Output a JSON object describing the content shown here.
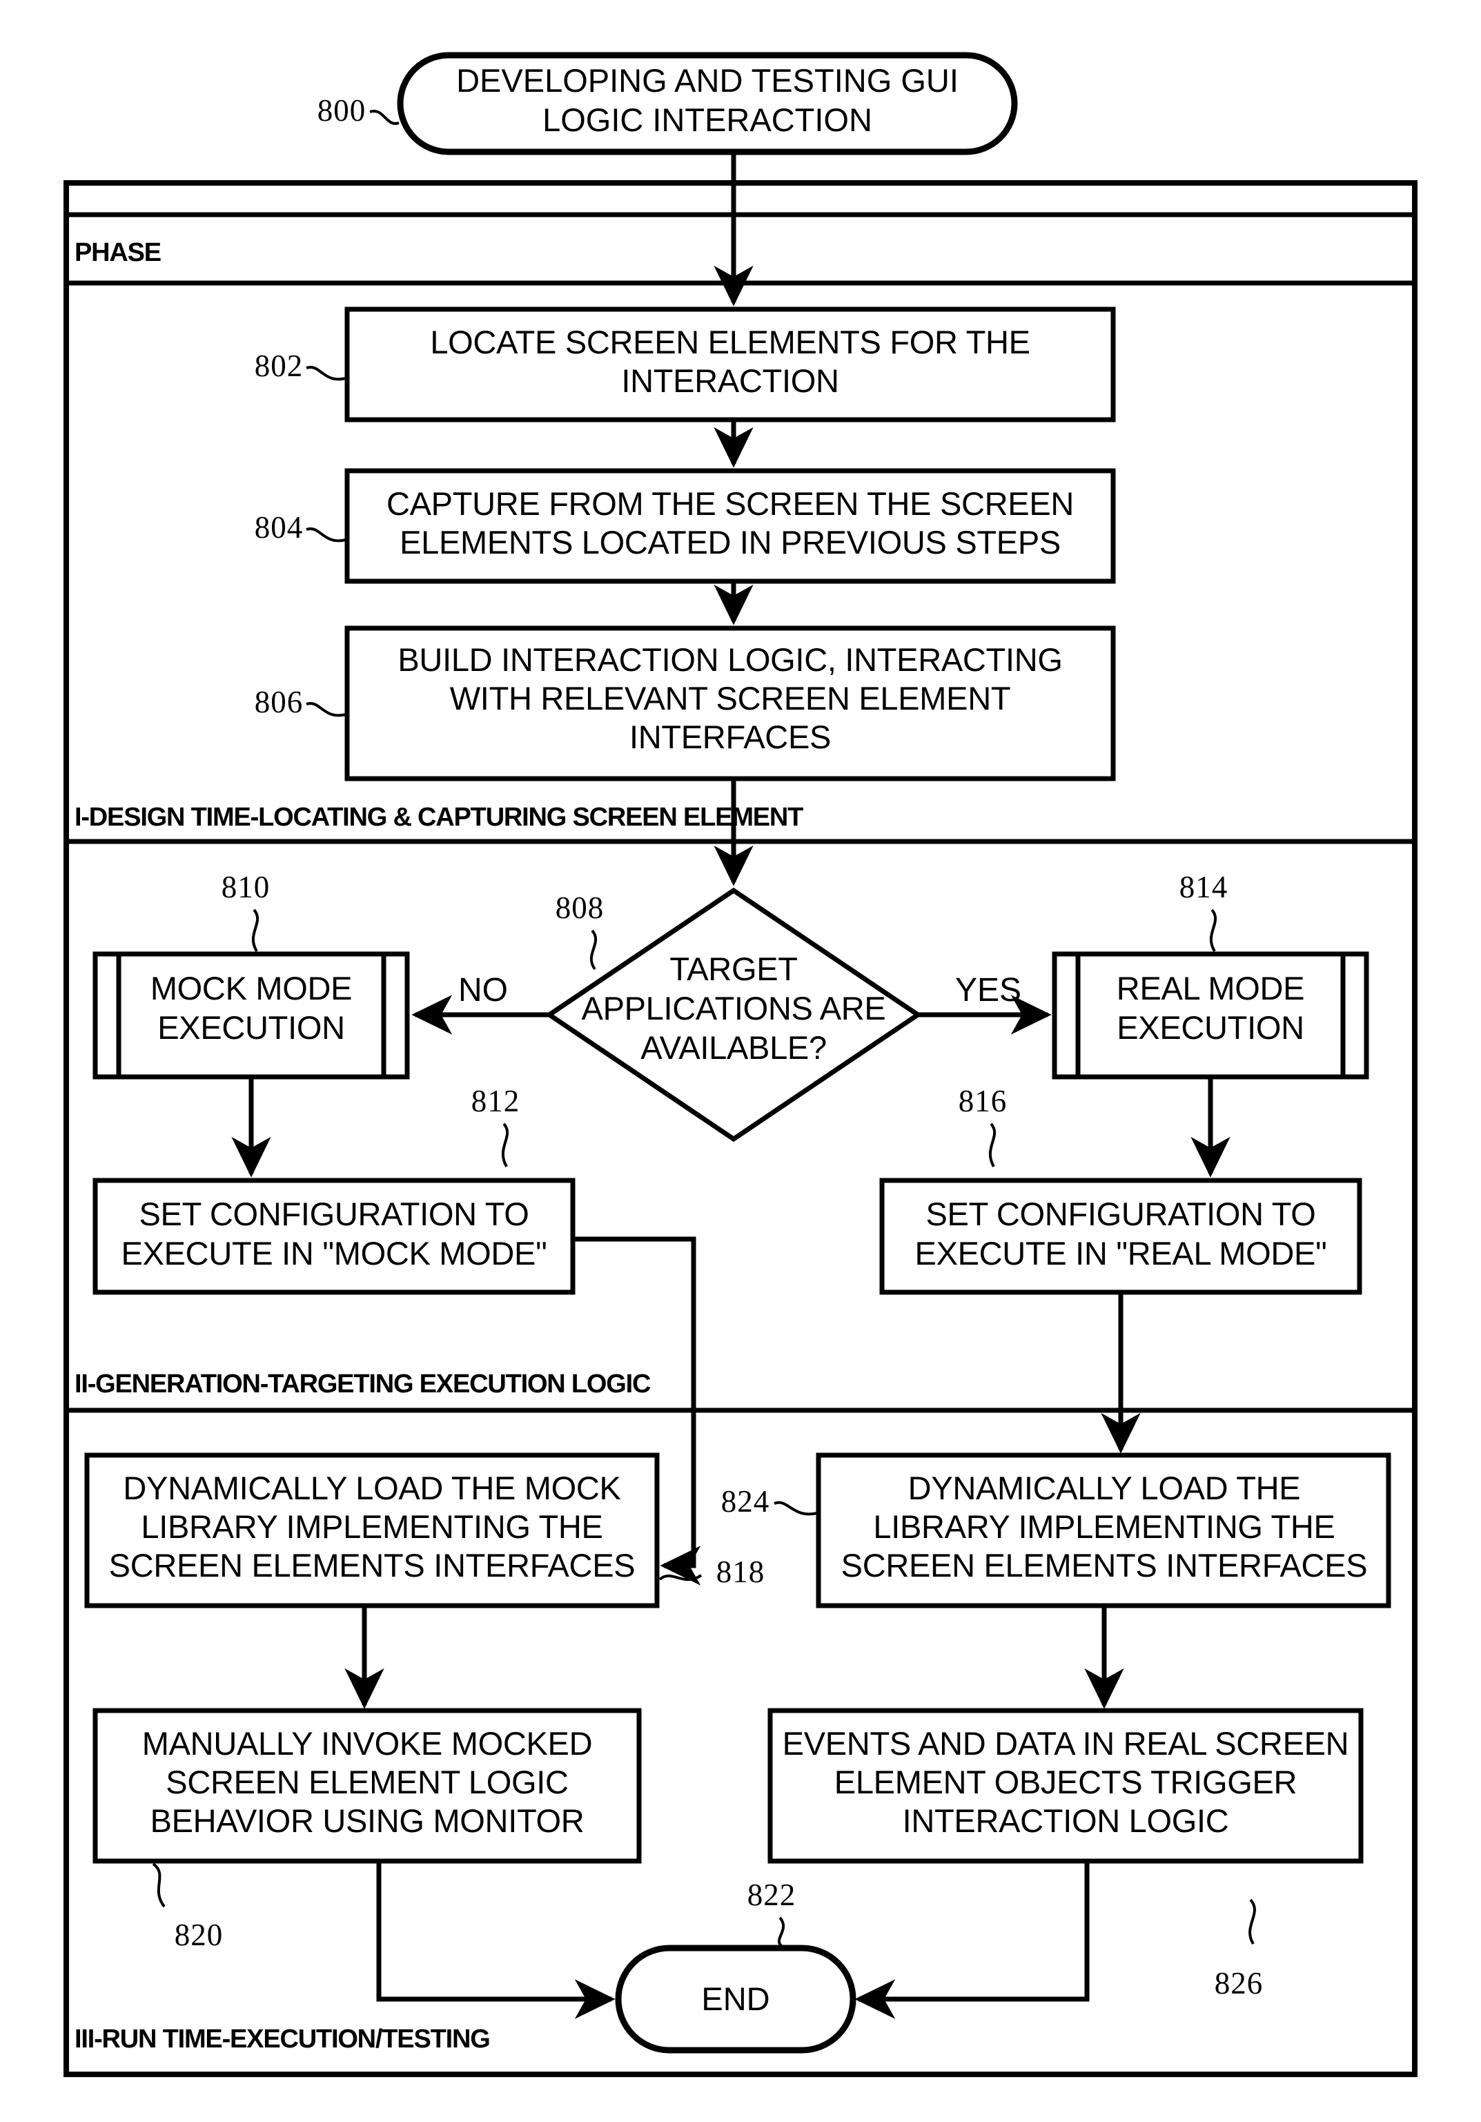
{
  "figure": {
    "type": "patent-flowchart",
    "start_label": "DEVELOPING AND TESTING GUI LOGIC INTERACTION",
    "start_ref": "800",
    "end_label": "END",
    "end_ref": "822",
    "header_label": "PHASE"
  },
  "phases": [
    {
      "id": "phase-1",
      "label": "I-DESIGN TIME-LOCATING & CAPTURING SCREEN ELEMENT"
    },
    {
      "id": "phase-2",
      "label": "II-GENERATION-TARGETING EXECUTION LOGIC"
    },
    {
      "id": "phase-3",
      "label": "III-RUN TIME-EXECUTION/TESTING"
    }
  ],
  "nodes": {
    "n802": {
      "ref": "802",
      "shape": "process",
      "line1": "LOCATE SCREEN ELEMENTS FOR THE",
      "line2": "INTERACTION",
      "line3": ""
    },
    "n804": {
      "ref": "804",
      "shape": "process",
      "line1": "CAPTURE FROM THE SCREEN THE SCREEN",
      "line2": "ELEMENTS LOCATED IN PREVIOUS STEPS",
      "line3": ""
    },
    "n806": {
      "ref": "806",
      "shape": "process",
      "line1": "BUILD INTERACTION LOGIC, INTERACTING",
      "line2": "WITH RELEVANT SCREEN ELEMENT",
      "line3": "INTERFACES"
    },
    "n808": {
      "ref": "808",
      "shape": "decision",
      "line1": "TARGET",
      "line2": "APPLICATIONS ARE",
      "line3": "AVAILABLE?"
    },
    "n810": {
      "ref": "810",
      "shape": "predefined-process",
      "line1": "MOCK MODE",
      "line2": "EXECUTION",
      "line3": ""
    },
    "n812": {
      "ref": "812",
      "shape": "process",
      "line1": "SET CONFIGURATION TO",
      "line2": "EXECUTE IN \"MOCK MODE\"",
      "line3": ""
    },
    "n814": {
      "ref": "814",
      "shape": "predefined-process",
      "line1": "REAL MODE",
      "line2": "EXECUTION",
      "line3": ""
    },
    "n816": {
      "ref": "816",
      "shape": "process",
      "line1": "SET CONFIGURATION TO",
      "line2": "EXECUTE IN \"REAL MODE\"",
      "line3": ""
    },
    "n818": {
      "ref": "818",
      "shape": "process",
      "line1": "DYNAMICALLY LOAD THE MOCK",
      "line2": "LIBRARY IMPLEMENTING THE",
      "line3": "SCREEN ELEMENTS INTERFACES"
    },
    "n820": {
      "ref": "820",
      "shape": "process",
      "line1": "MANUALLY INVOKE MOCKED",
      "line2": "SCREEN ELEMENT LOGIC",
      "line3": "BEHAVIOR USING MONITOR"
    },
    "n824": {
      "ref": "824",
      "shape": "process",
      "line1": "DYNAMICALLY LOAD THE",
      "line2": "LIBRARY IMPLEMENTING THE",
      "line3": "SCREEN ELEMENTS INTERFACES"
    },
    "n826": {
      "ref": "826",
      "shape": "process",
      "line1": "EVENTS AND DATA IN REAL SCREEN",
      "line2": "ELEMENT OBJECTS TRIGGER",
      "line3": "INTERACTION LOGIC"
    }
  },
  "branches": {
    "no_label": "NO",
    "yes_label": "YES"
  },
  "colors": {
    "stroke": "#000000",
    "fill": "#ffffff"
  }
}
